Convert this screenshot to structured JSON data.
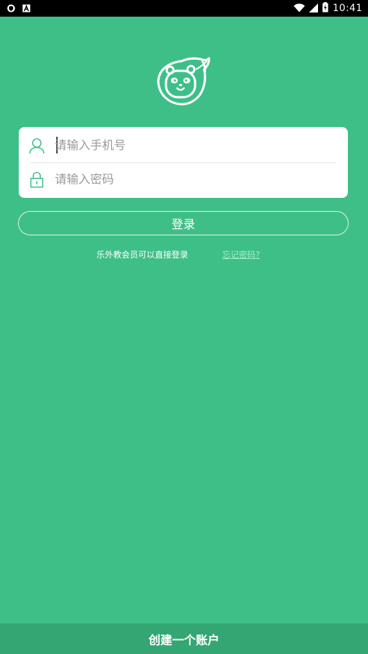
{
  "status_bar": {
    "time": "10:41",
    "icons": [
      "shield-icon",
      "a-letter-icon",
      "wifi-icon",
      "signal-icon",
      "battery-charging-icon"
    ]
  },
  "logo": {
    "icon": "panda-face-logo-icon",
    "color": "#ffffff"
  },
  "login_form": {
    "phone": {
      "icon": "user-icon",
      "placeholder": "请输入手机号",
      "value": ""
    },
    "password": {
      "icon": "lock-icon",
      "placeholder": "请输入密码",
      "value": ""
    },
    "login_label": "登录"
  },
  "hint": "乐外教会员可以直接登录",
  "forgot_password": "忘记密码?",
  "create_account_label": "创建一个账户",
  "colors": {
    "background": "#3fbf88",
    "bottom_bar": "#33a673",
    "icon_accent": "#3fbf88",
    "link": "#a6f0c8"
  }
}
